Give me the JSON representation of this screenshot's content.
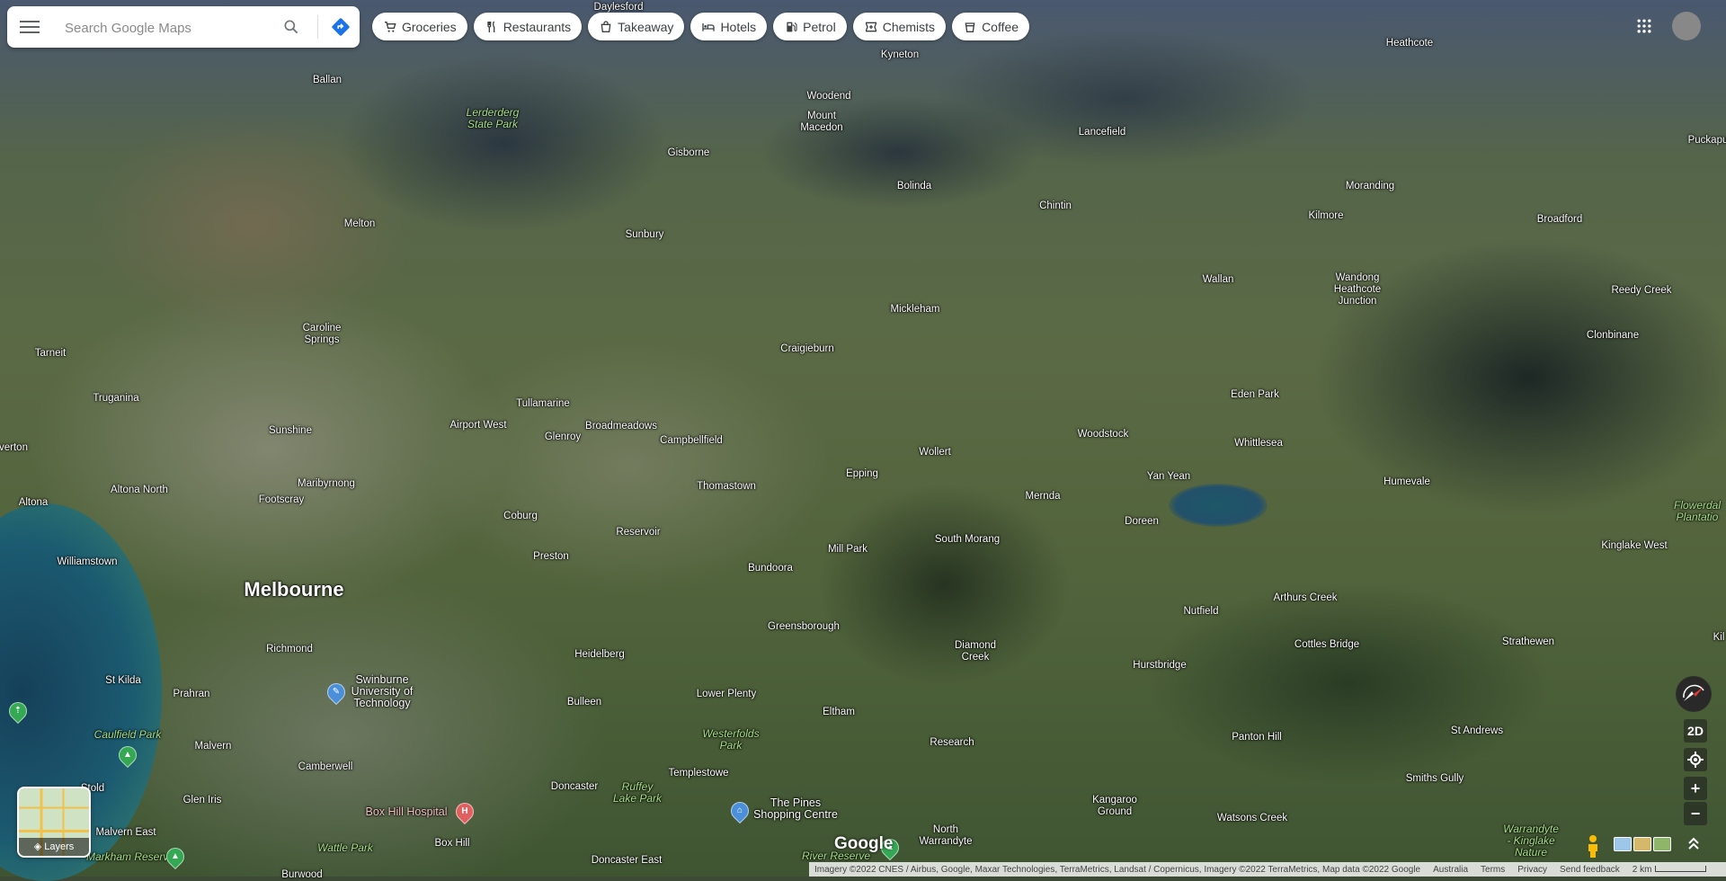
{
  "search": {
    "placeholder": "Search Google Maps"
  },
  "chips": [
    {
      "label": "Groceries",
      "icon": "cart-icon"
    },
    {
      "label": "Restaurants",
      "icon": "fork-knife-icon"
    },
    {
      "label": "Takeaway",
      "icon": "takeaway-bag-icon"
    },
    {
      "label": "Hotels",
      "icon": "bed-icon"
    },
    {
      "label": "Petrol",
      "icon": "fuel-pump-icon"
    },
    {
      "label": "Chemists",
      "icon": "pharmacy-icon"
    },
    {
      "label": "Coffee",
      "icon": "coffee-cup-icon"
    }
  ],
  "controls": {
    "mode": "2D",
    "zoom_in": "+",
    "zoom_out": "−"
  },
  "layers_label": "Layers",
  "logo": "Google",
  "footer": {
    "attribution": "Imagery ©2022 CNES / Airbus, Google, Maxar Technologies, TerraMetrics, Landsat / Copernicus, Imagery ©2022 TerraMetrics, Map data ©2022 Google",
    "country": "Australia",
    "terms": "Terms",
    "privacy": "Privacy",
    "feedback": "Send feedback",
    "scale": "2 km"
  },
  "places": {
    "daylesford": "Daylesford",
    "kyneton": "Kyneton",
    "heathcote": "Heathcote",
    "ballan": "Ballan",
    "lerderderg": "Lerderderg\nState Park",
    "woodend": "Woodend",
    "mount_macedon": "Mount\nMacedon",
    "lancefield": "Lancefield",
    "puckapunyal": "Puckapu",
    "gisborne": "Gisborne",
    "bolinda": "Bolinda",
    "morang": "Moranding",
    "chintin": "Chintin",
    "kilmore": "Kilmore",
    "broadford": "Broadford",
    "melton": "Melton",
    "sunbury": "Sunbury",
    "wallan": "Wallan",
    "wandong": "Wandong\nHeathcote\nJunction",
    "reedy_creek": "Reedy Creek",
    "caroline_springs": "Caroline\nSprings",
    "mickleham": "Mickleham",
    "clonbinane": "Clonbinane",
    "tarneit": "Tarneit",
    "craigieburn": "Craigieburn",
    "truganina": "Truganina",
    "tullamarine": "Tullamarine",
    "eden_park": "Eden Park",
    "sunshine": "Sunshine",
    "airport_west": "Airport West",
    "broadmeadows": "Broadmeadows",
    "woodstock": "Woodstock",
    "glenroy": "Glenroy",
    "campbellfield": "Campbellfield",
    "whittlesea": "Whittlesea",
    "werribee": "verton",
    "wollert": "Wollert",
    "epping": "Epping",
    "yan_yean": "Yan Yean",
    "humevale": "Humevale",
    "altona_north": "Altona North",
    "maribyrnong": "Maribyrnong",
    "thomastown": "Thomastown",
    "flowerdale": "Flowerdal\nPlantatio",
    "altona": "Altona",
    "footscray": "Footscray",
    "mernda": "Mernda",
    "coburg": "Coburg",
    "reservoir": "Reservoir",
    "doreen": "Doreen",
    "kinglake_west": "Kinglake West",
    "south_morang": "South Morang",
    "mill_park": "Mill Park",
    "williamstown": "Williamstown",
    "preston": "Preston",
    "bundoora": "Bundoora",
    "arthurs_creek": "Arthurs Creek",
    "melbourne": "Melbourne",
    "nutfield": "Nutfield",
    "greensborough": "Greensborough",
    "strathewen": "Strathewen",
    "cottles_bridge": "Cottles Bridge",
    "richmond": "Richmond",
    "diamond_creek": "Diamond\nCreek",
    "heidelberg": "Heidelberg",
    "hurstbridge": "Hurstbridge",
    "st_kilda": "St Kilda",
    "swinburne": "Swinburne\nUniversity of\nTechnology",
    "prahran": "Prahran",
    "lower_plenty": "Lower Plenty",
    "bulleen": "Bulleen",
    "eltham": "Eltham",
    "st_andrews": "St Andrews",
    "panton_hill": "Panton Hill",
    "westerfolds": "Westerfolds\nPark",
    "caulfield_park": "Caulfield Park",
    "research": "Research",
    "malvern": "Malvern",
    "templestowe": "Templestowe",
    "camberwell": "Camberwell",
    "smiths_gully": "Smiths Gully",
    "doncaster": "Doncaster",
    "ruffey_lake": "Ruffey\nLake Park",
    "glen_iris": "Glen Iris",
    "the_pines": "The Pines\nShopping Centre",
    "kangaroo_ground": "Kangaroo\nGround",
    "box_hill_hospital": "Box Hill Hospital",
    "watsons_creek": "Watsons Creek",
    "warrandyte_kinglake": "Warrandyte\n- Kinglake\nNature",
    "malvern_east": "Malvern East",
    "north_warrandyte": "North\nWarrandyte",
    "wattle_park": "Wattle Park",
    "box_hill": "Box Hill",
    "markham_reserve": "Markham Reserve",
    "doncaster_east": "Doncaster East",
    "warrandyte_river": "River Reserve",
    "oakleigh": "Stold",
    "kilc": "Kil",
    "burwood": "Burwood"
  }
}
